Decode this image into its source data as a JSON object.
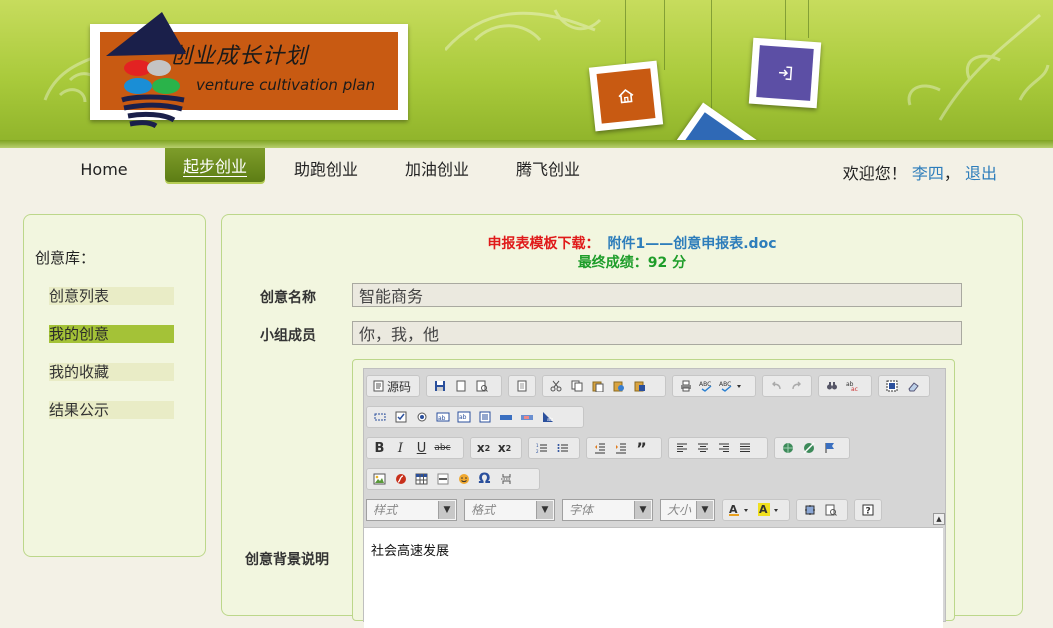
{
  "logo": {
    "cn": "创业成长计划",
    "en": "venture cultivation plan"
  },
  "tiles": {
    "home": "home-icon",
    "login": "sign-in-icon",
    "logout": "sign-out-icon"
  },
  "nav": {
    "items": [
      "Home",
      "起步创业",
      "助跑创业",
      "加油创业",
      "腾飞创业"
    ],
    "active": "起步创业"
  },
  "user": {
    "welcome": "欢迎您！",
    "name": "李四",
    "separator": "，",
    "logout": "退出"
  },
  "sidebar": {
    "title": "创意库：",
    "items": [
      "创意列表",
      "我的创意",
      "我的收藏",
      "结果公示"
    ],
    "active": "我的创意"
  },
  "main": {
    "download_label": "申报表模板下载：",
    "download_link": "附件1——创意申报表.doc",
    "score": "最终成绩：92 分",
    "fields": {
      "idea_name_label": "创意名称",
      "idea_name_value": "智能商务",
      "members_label": "小组成员",
      "members_value": "你，我，他",
      "background_label": "创意背景说明"
    }
  },
  "editor": {
    "source_label": "源码",
    "combos": {
      "style": "样式",
      "format": "格式",
      "font": "字体",
      "size": "大小"
    },
    "content": "社会高速发展"
  },
  "colors": {
    "header_green": "#a9ca3b",
    "nav_active": "#6f8f1f",
    "sidebar_active": "#a4c237",
    "download_label": "#e01a1a",
    "link": "#2d7dbb",
    "score": "#1e9d2a"
  }
}
